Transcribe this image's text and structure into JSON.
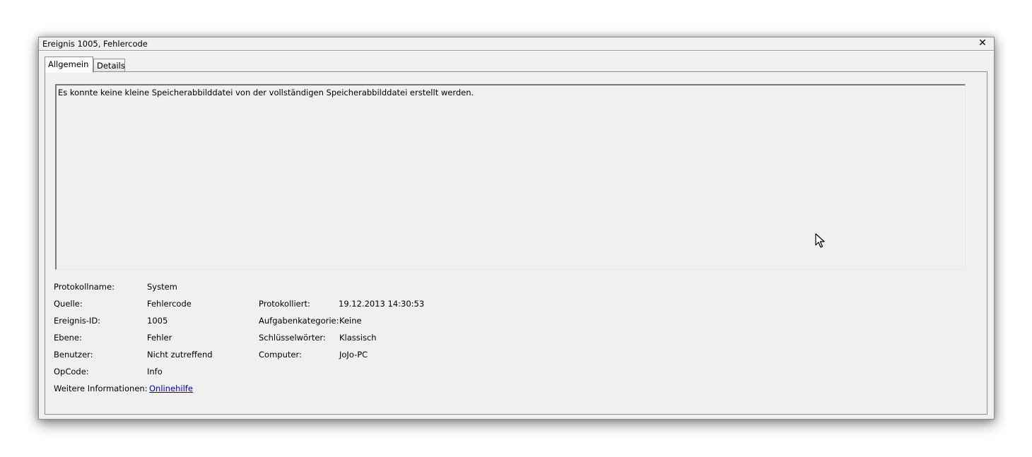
{
  "window": {
    "title": "Ereignis 1005, Fehlercode",
    "close_label": "✕"
  },
  "tabs": [
    {
      "label": "Allgemein",
      "active": true
    },
    {
      "label": "Details",
      "active": false
    }
  ],
  "description": "Es konnte keine kleine Speicherabbilddatei von der vollständigen Speicherabbilddatei erstellt werden.",
  "fields": {
    "protokollname": {
      "label": "Protokollname:",
      "value": "System"
    },
    "quelle": {
      "label": "Quelle:",
      "value": "Fehlercode"
    },
    "protokolliert": {
      "label": "Protokolliert:",
      "value": "19.12.2013 14:30:53"
    },
    "ereignis_id": {
      "label": "Ereignis-ID:",
      "value": "1005"
    },
    "aufgabenkategorie": {
      "label": "Aufgabenkategorie:",
      "value": "Keine"
    },
    "ebene": {
      "label": "Ebene:",
      "value": "Fehler"
    },
    "schluesselwoerter": {
      "label": "Schlüsselwörter:",
      "value": "Klassisch"
    },
    "benutzer": {
      "label": "Benutzer:",
      "value": "Nicht zutreffend"
    },
    "computer": {
      "label": "Computer:",
      "value": "JoJo-PC"
    },
    "opcode": {
      "label": "OpCode:",
      "value": "Info"
    },
    "weitere_informationen": {
      "label": "Weitere Informationen:",
      "value": "Onlinehilfe"
    }
  },
  "colors": {
    "link": "#0000cc",
    "window_bg": "#f0f0f0"
  },
  "icons": {
    "cursor": "mouse-pointer-icon"
  }
}
